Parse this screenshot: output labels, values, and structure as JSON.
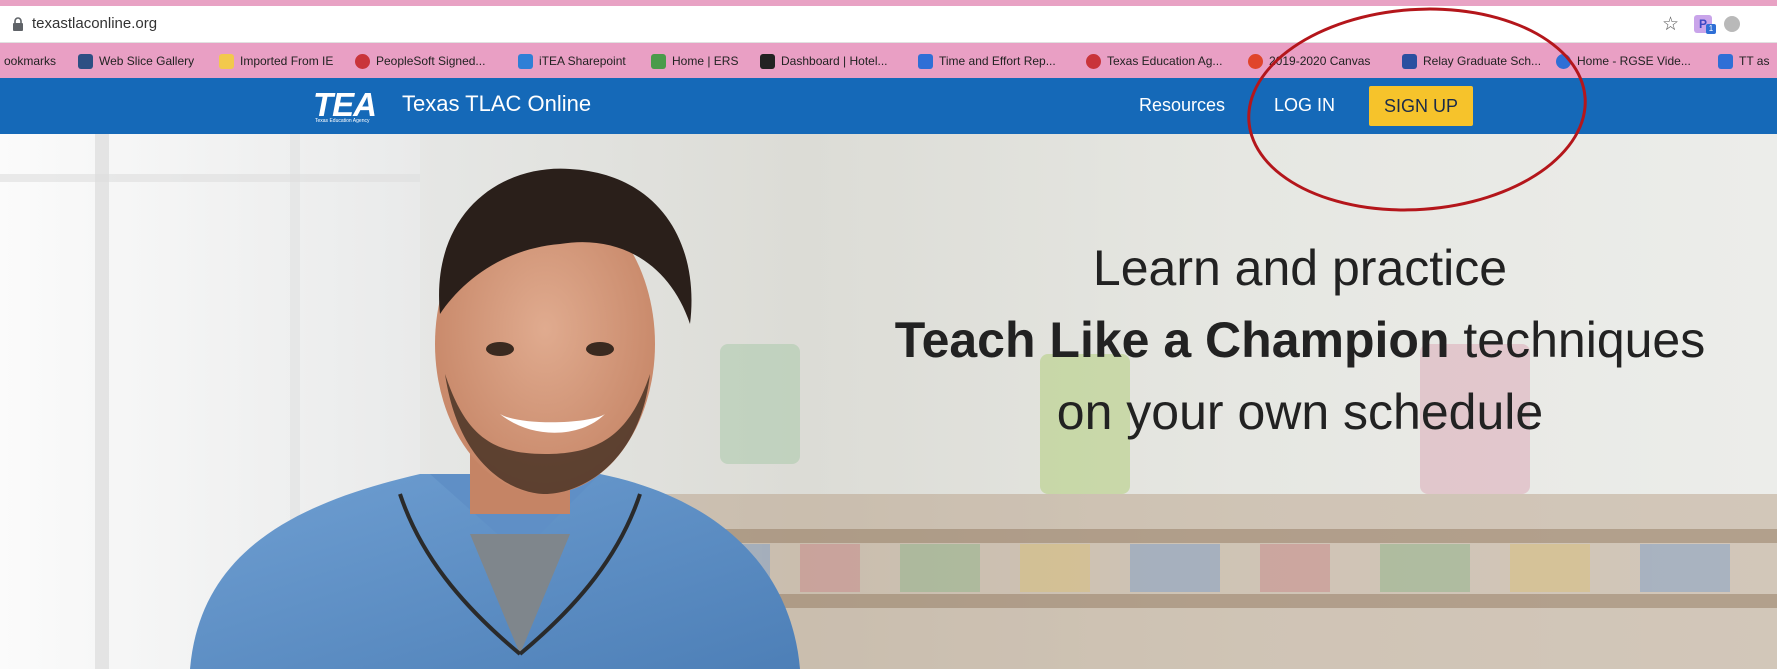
{
  "browser": {
    "url": "texastlaconline.org",
    "bookmarks": [
      {
        "label": "ookmarks",
        "icon": "none"
      },
      {
        "label": "Web Slice Gallery",
        "icon": "web-slice-icon",
        "color": "#2d4f83"
      },
      {
        "label": "Imported From IE",
        "icon": "folder-icon",
        "color": "#f2c94c"
      },
      {
        "label": "PeopleSoft Signed...",
        "icon": "peoplesoft-icon",
        "color": "#c9343a"
      },
      {
        "label": "iTEA Sharepoint",
        "icon": "sharepoint-icon",
        "color": "#2f7fd6"
      },
      {
        "label": "Home | ERS",
        "icon": "ers-icon",
        "color": "#4a9b4a"
      },
      {
        "label": "Dashboard | Hotel...",
        "icon": "hotel-icon",
        "color": "#222222"
      },
      {
        "label": "Time and Effort Rep...",
        "icon": "tea-small-icon",
        "color": "#2f6fd6"
      },
      {
        "label": "Texas Education Ag...",
        "icon": "tea-agency-icon",
        "color": "#c9343a"
      },
      {
        "label": "2019-2020 Canvas",
        "icon": "canvas-icon",
        "color": "#e0452b"
      },
      {
        "label": "Relay Graduate Sch...",
        "icon": "relay-icon",
        "color": "#2b4fa0"
      },
      {
        "label": "Home - RGSE Vide...",
        "icon": "rgse-icon",
        "color": "#2f6fd6"
      },
      {
        "label": "TT as",
        "icon": "tt-icon",
        "color": "#2f6fd6"
      }
    ],
    "ext_letter": "P",
    "ext_badge": "1"
  },
  "site": {
    "logo_text": "TEA",
    "logo_tagline": "Texas Education Agency",
    "title": "Texas TLAC Online",
    "nav": {
      "resources": "Resources",
      "login": "LOG IN",
      "signup": "SIGN UP"
    },
    "colors": {
      "nav_bg": "#1569b8",
      "signup_bg": "#f6c32b",
      "annotation": "#b4161b"
    }
  },
  "hero": {
    "line1": "Learn and practice",
    "line2_bold": "Teach Like a Champion",
    "line2_rest": " techniques",
    "line3": "on your own schedule"
  }
}
